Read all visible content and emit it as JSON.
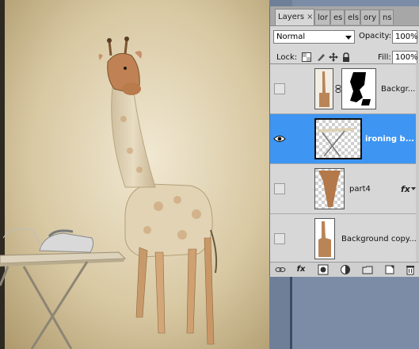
{
  "panel": {
    "tabs": [
      {
        "label": "Layers",
        "close": "×",
        "active": true
      },
      {
        "label": "lor",
        "active": false
      },
      {
        "label": "es",
        "active": false
      },
      {
        "label": "els",
        "active": false
      },
      {
        "label": "ory",
        "active": false
      },
      {
        "label": "ns",
        "active": false
      }
    ],
    "blend_mode": "Normal",
    "opacity_label": "Opacity:",
    "opacity_value": "100%",
    "lock_label": "Lock:",
    "fill_label": "Fill:",
    "fill_value": "100%"
  },
  "layers": [
    {
      "name": "Backgr...",
      "visible": false,
      "selected": false,
      "has_mask": true,
      "has_fx": false
    },
    {
      "name": "ironing b...",
      "visible": true,
      "selected": true,
      "has_mask": false,
      "has_fx": false
    },
    {
      "name": "part4",
      "visible": false,
      "selected": false,
      "has_mask": false,
      "has_fx": true,
      "fx_label": "fx"
    },
    {
      "name": "Background copy...",
      "visible": false,
      "selected": false,
      "has_mask": false,
      "has_fx": false
    }
  ],
  "bottom_bar": {
    "icons": [
      "link-icon",
      "fx-icon",
      "mask-icon",
      "adjustment-icon",
      "group-folder-icon",
      "new-layer-icon",
      "trash-icon"
    ],
    "fx_label": "fx"
  },
  "colors": {
    "selected_row": "#3e95f2",
    "panel_bg": "#d7d7d7",
    "canvas_bg": "#c9b995"
  }
}
